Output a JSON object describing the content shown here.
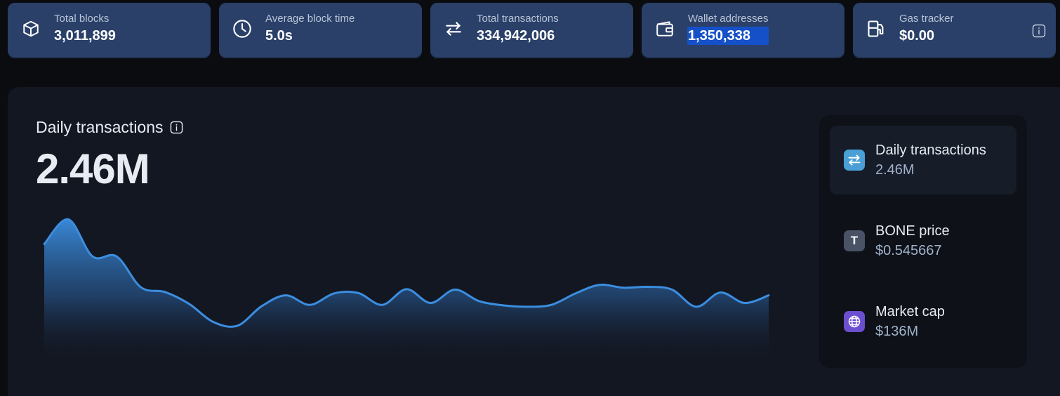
{
  "stats": [
    {
      "label": "Total blocks",
      "value": "3,011,899",
      "icon": "cube-icon"
    },
    {
      "label": "Average block time",
      "value": "5.0s",
      "icon": "clock-icon"
    },
    {
      "label": "Total transactions",
      "value": "334,942,006",
      "icon": "transfer-arrows-icon"
    },
    {
      "label": "Wallet addresses",
      "value": "1,350,338",
      "icon": "wallet-icon"
    },
    {
      "label": "Gas tracker",
      "value": "$0.00",
      "icon": "gas-pump-icon"
    }
  ],
  "chart": {
    "title": "Daily transactions",
    "value": "2.46M"
  },
  "chart_data": {
    "type": "area",
    "title": "Daily transactions",
    "xlabel": "",
    "ylabel": "",
    "values": [
      2.46,
      2.98,
      2.2,
      2.2,
      1.55,
      1.45,
      1.2,
      0.82,
      0.74,
      1.15,
      1.38,
      1.18,
      1.42,
      1.43,
      1.18,
      1.51,
      1.22,
      1.5,
      1.26,
      1.17,
      1.14,
      1.18,
      1.42,
      1.6,
      1.54,
      1.56,
      1.5,
      1.14,
      1.44,
      1.22,
      1.38
    ],
    "ylim": [
      0,
      3.4
    ],
    "grid": false,
    "legend": "none",
    "color": "#3b8ee0"
  },
  "side": [
    {
      "label": "Daily transactions",
      "value": "2.46M",
      "icon": "transfer-arrows-icon",
      "icon_text": "",
      "color": "#4a9fd4",
      "active": true
    },
    {
      "label": "BONE price",
      "value": "$0.545667",
      "icon": "token-t-icon",
      "icon_text": "T",
      "color": "#4a5266",
      "active": false
    },
    {
      "label": "Market cap",
      "value": "$136M",
      "icon": "globe-icon",
      "icon_text": "",
      "color": "#6b4fd0",
      "active": false
    }
  ]
}
